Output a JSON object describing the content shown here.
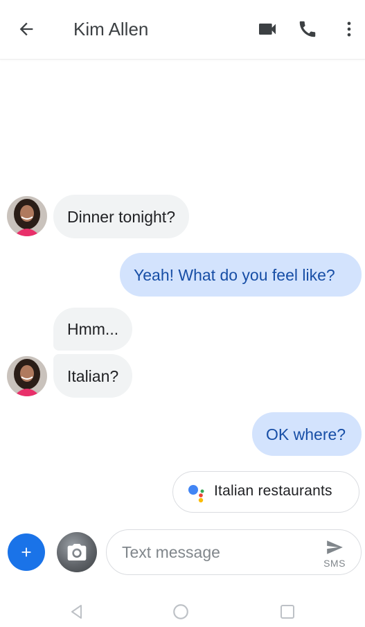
{
  "header": {
    "title": "Kim Allen",
    "icons": [
      "arrow-back-icon",
      "videocam-icon",
      "phone-icon",
      "more-vert-icon"
    ]
  },
  "messages": [
    {
      "direction": "incoming",
      "text": "Dinner tonight?"
    },
    {
      "direction": "outgoing",
      "text": "Yeah! What do you feel like?"
    },
    {
      "direction": "incoming",
      "text": "Hmm..."
    },
    {
      "direction": "incoming",
      "text": "Italian?"
    },
    {
      "direction": "outgoing",
      "text": "OK where?"
    }
  ],
  "suggestion": {
    "label": "Italian restaurants",
    "icon": "google-assistant-icon"
  },
  "compose": {
    "placeholder": "Text message",
    "value": "",
    "send_label": "SMS"
  },
  "colors": {
    "incoming_bubble": "#f1f3f4",
    "outgoing_bubble": "#d3e3fd",
    "outgoing_text": "#174ea6",
    "accent": "#1a73e8"
  },
  "navbar": {
    "icons": [
      "nav-back-icon",
      "nav-home-icon",
      "nav-recents-icon"
    ]
  }
}
